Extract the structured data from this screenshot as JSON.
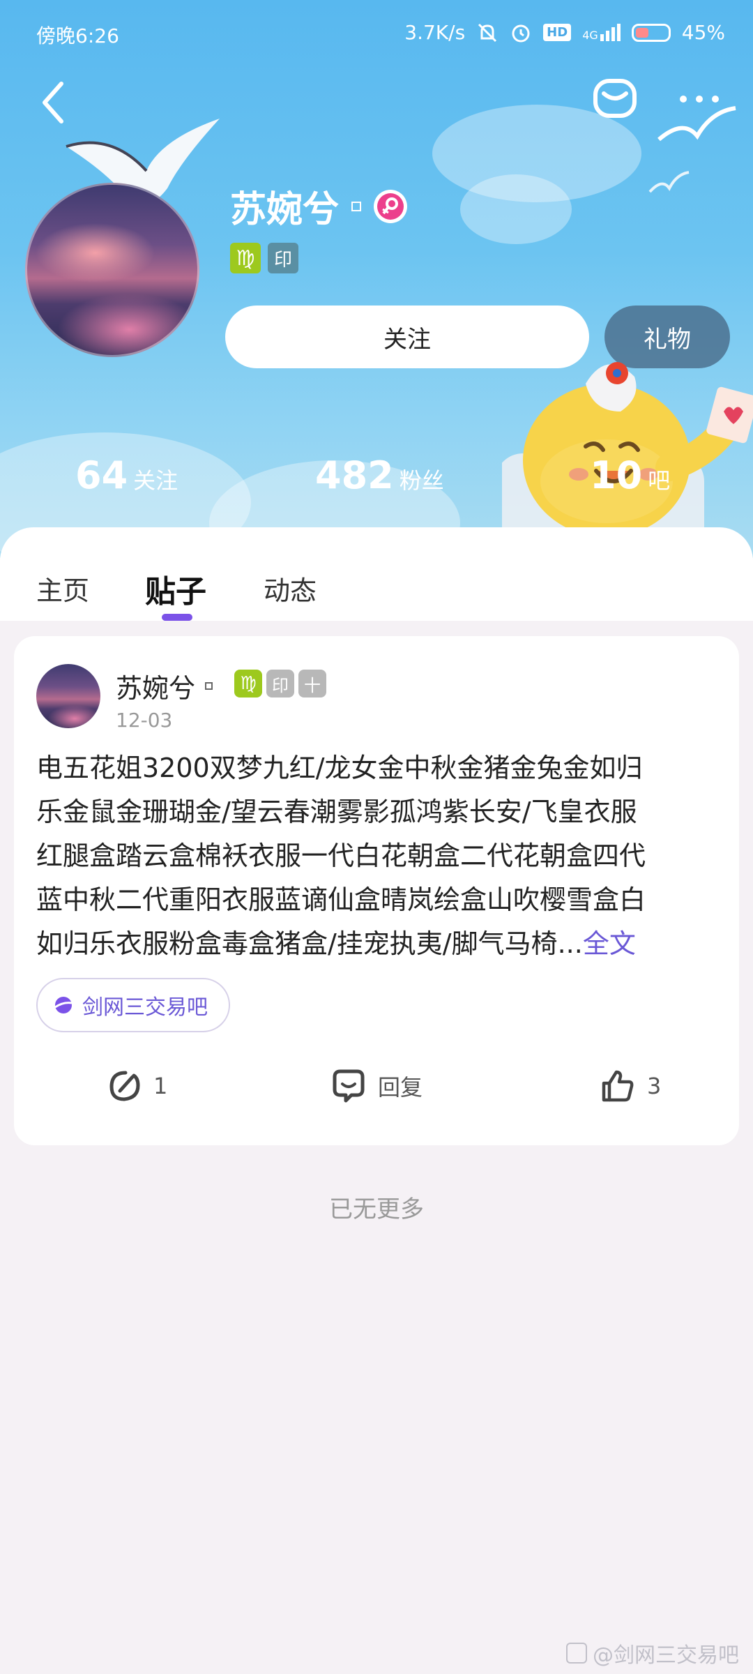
{
  "status_bar": {
    "time": "傍晚6:26",
    "network_speed": "3.7K/s",
    "hd": "HD",
    "signal": "4G",
    "battery": "45%"
  },
  "header": {
    "back_icon": "chevron-left-icon",
    "mail_icon": "mail-icon",
    "more_icon": "more-icon"
  },
  "profile": {
    "name": "苏婉兮",
    "gender": "female",
    "tags": [
      "♍",
      "印"
    ],
    "follow_label": "关注",
    "gift_label": "礼物"
  },
  "stats": {
    "following": {
      "value": "64",
      "label": "关注"
    },
    "fans": {
      "value": "482",
      "label": "粉丝"
    },
    "bars": {
      "value": "10",
      "label": "吧"
    }
  },
  "tabs": [
    {
      "label": "主页",
      "active": false
    },
    {
      "label": "贴子",
      "active": true
    },
    {
      "label": "动态",
      "active": false
    }
  ],
  "post": {
    "author": "苏婉兮",
    "tags": [
      "♍",
      "印",
      "十"
    ],
    "date": "12-03",
    "lines": [
      "电五花姐3200双梦九红/龙女金中秋金猪金兔金如归",
      "乐金鼠金珊瑚金/望云春潮雾影孤鸿紫长安/飞皇衣服",
      "红腿盒踏云盒棉袄衣服一代白花朝盒二代花朝盒四代",
      "蓝中秋二代重阳衣服蓝谪仙盒晴岚绘盒山吹樱雪盒白",
      "如归乐衣服粉盒毒盒猪盒/挂宠执夷/脚气马椅..."
    ],
    "read_full": "全文",
    "forum": "剑网三交易吧",
    "share_count": "1",
    "reply_label": "回复",
    "like_count": "3"
  },
  "footer": {
    "no_more": "已无更多",
    "watermark": "@剑网三交易吧"
  },
  "colors": {
    "accent": "#7b52e8",
    "link": "#6a58d6",
    "banner_top": "#58b8ef"
  }
}
